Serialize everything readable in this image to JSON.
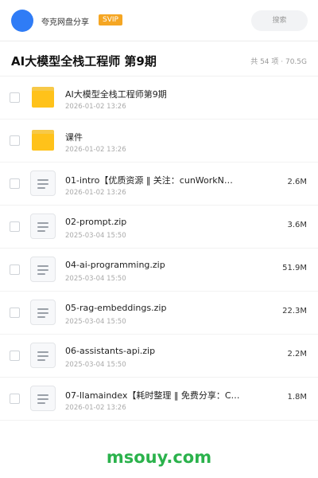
{
  "header": {
    "username": "夸克网盘分享",
    "badge": "SVIP",
    "search_label": "搜索",
    "colors": {
      "avatar": "#2f7cf6",
      "badge": "#f5a623"
    }
  },
  "folder": {
    "title": "AI大模型全栈工程师 第9期",
    "summary": "共 54 项 · 70.5G"
  },
  "files": [
    {
      "name": "AI大模型全栈工程师第9期",
      "date": "2026-01-02 13:26",
      "size": "",
      "icon": "folder-icon"
    },
    {
      "name": "课件",
      "date": "2026-01-02 13:26",
      "size": "",
      "icon": "folder-icon"
    },
    {
      "name": "01-intro【优质资源 ‖ 关注：cunWorkN…",
      "date": "2026-01-02 13:26",
      "size": "2.6M",
      "icon": "file-icon"
    },
    {
      "name": "02-prompt.zip",
      "date": "2025-03-04 15:50",
      "size": "3.6M",
      "icon": "file-icon"
    },
    {
      "name": "04-ai-programming.zip",
      "date": "2025-03-04 15:50",
      "size": "51.9M",
      "icon": "file-icon"
    },
    {
      "name": "05-rag-embeddings.zip",
      "date": "2025-03-04 15:50",
      "size": "22.3M",
      "icon": "file-icon"
    },
    {
      "name": "06-assistants-api.zip",
      "date": "2025-03-04 15:50",
      "size": "2.2M",
      "icon": "file-icon"
    },
    {
      "name": "07-llamaindex【耗时整理 ‖ 免费分享：C…",
      "date": "2026-01-02 13:26",
      "size": "1.8M",
      "icon": "file-icon"
    }
  ],
  "watermark": "msouy.com"
}
